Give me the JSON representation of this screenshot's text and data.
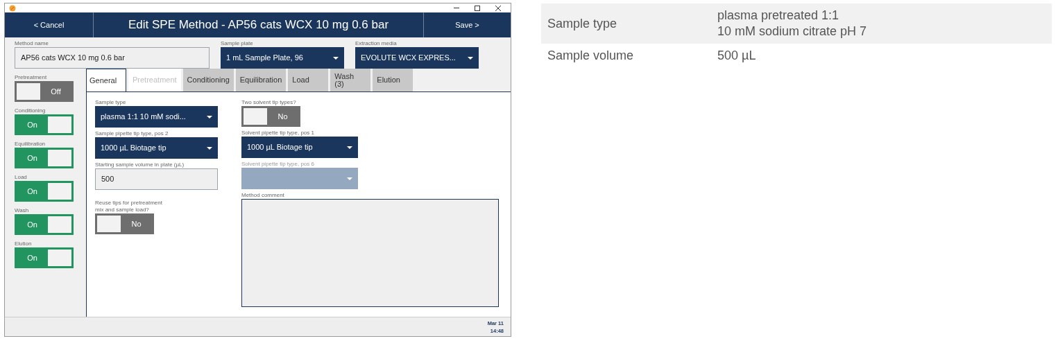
{
  "header": {
    "cancel": "< Cancel",
    "title": "Edit SPE Method - AP56 cats WCX 10 mg 0.6 bar",
    "save": "Save >"
  },
  "top_fields": [
    {
      "kind": "input",
      "label": "Method name",
      "value": "AP56 cats WCX 10 mg 0.6 bar"
    },
    {
      "kind": "dropdown",
      "label": "Sample plate",
      "value": "1 mL Sample Plate, 96"
    },
    {
      "kind": "dropdown",
      "label": "Extraction media",
      "value": "EVOLUTE WCX EXPRES..."
    }
  ],
  "steps": [
    {
      "label": "Pretreatment",
      "on": false,
      "state_text": "Off"
    },
    {
      "label": "Conditioning",
      "on": true,
      "state_text": "On"
    },
    {
      "label": "Equilibration",
      "on": true,
      "state_text": "On"
    },
    {
      "label": "Load",
      "on": true,
      "state_text": "On"
    },
    {
      "label": "Wash",
      "on": true,
      "state_text": "On"
    },
    {
      "label": "Elution",
      "on": true,
      "state_text": "On"
    }
  ],
  "tabs": [
    {
      "label": "General",
      "selected": true,
      "disabled": false
    },
    {
      "label": "Pretreatment",
      "selected": false,
      "disabled": true
    },
    {
      "label": "Conditioning",
      "selected": false,
      "disabled": false
    },
    {
      "label": "Equilibration",
      "selected": false,
      "disabled": false
    },
    {
      "label": "Load",
      "selected": false,
      "disabled": false
    },
    {
      "label": "Wash\n(3)",
      "selected": false,
      "disabled": false
    },
    {
      "label": "Elution",
      "selected": false,
      "disabled": false
    }
  ],
  "general_left": [
    {
      "kind": "dropdown",
      "label": "Sample type",
      "value": "plasma 1:1 10 mM sodi...",
      "disabled": false
    },
    {
      "kind": "dropdown",
      "label": "Sample pipette tip type, pos 2",
      "value": "1000 µL Biotage tip",
      "disabled": false
    },
    {
      "kind": "input",
      "label": "Starting sample volume in plate (µL)",
      "value": "500"
    },
    {
      "kind": "toggle",
      "label": "Reuse tips for pretreatment\nmix and sample load?",
      "on": false,
      "state_text": "No"
    }
  ],
  "general_right": [
    {
      "kind": "toggle",
      "label": "Two solvent tip types?",
      "on": false,
      "state_text": "No"
    },
    {
      "kind": "dropdown",
      "label": "Solvent pipette tip type, pos 1",
      "value": "1000 µL Biotage tip",
      "disabled": false
    },
    {
      "kind": "dropdown",
      "label": "Solvent pipette tip type, pos 6",
      "disabled": true
    },
    {
      "kind": "textarea",
      "label": "Method comment"
    }
  ],
  "footer": {
    "date": "Mar 11",
    "time": "14:48"
  },
  "summary_table": [
    {
      "label": "Sample type",
      "value": "plasma pretreated 1:1\n10 mM sodium citrate pH 7"
    },
    {
      "label": "Sample volume",
      "value": "500 µL"
    }
  ]
}
